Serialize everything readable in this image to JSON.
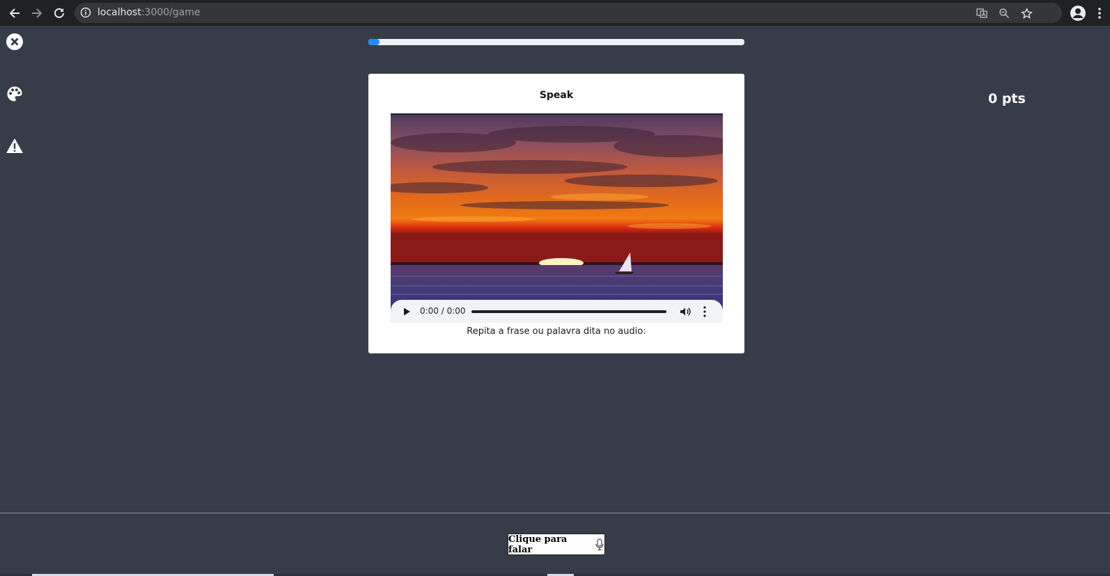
{
  "browser": {
    "url_host": "localhost",
    "url_path": ":3000/game",
    "icons": [
      "back-arrow-icon",
      "forward-arrow-icon",
      "reload-icon",
      "info-icon",
      "translate-icon",
      "zoom-icon",
      "star-icon",
      "profile-icon",
      "kebab-menu-icon"
    ]
  },
  "sidebar": {
    "icons": [
      "close-circle-icon",
      "palette-icon",
      "warning-icon"
    ]
  },
  "progress": {
    "value": 0.03,
    "color": "#1f8ffd"
  },
  "score": {
    "text": "0 pts"
  },
  "card": {
    "title": "Speak",
    "audio": {
      "time": "0:00 / 0:00"
    },
    "caption": "Repita a frase ou palavra dita no audio:"
  },
  "footer": {
    "button_label": "Clique para falar",
    "button_icon": "microphone-icon"
  }
}
